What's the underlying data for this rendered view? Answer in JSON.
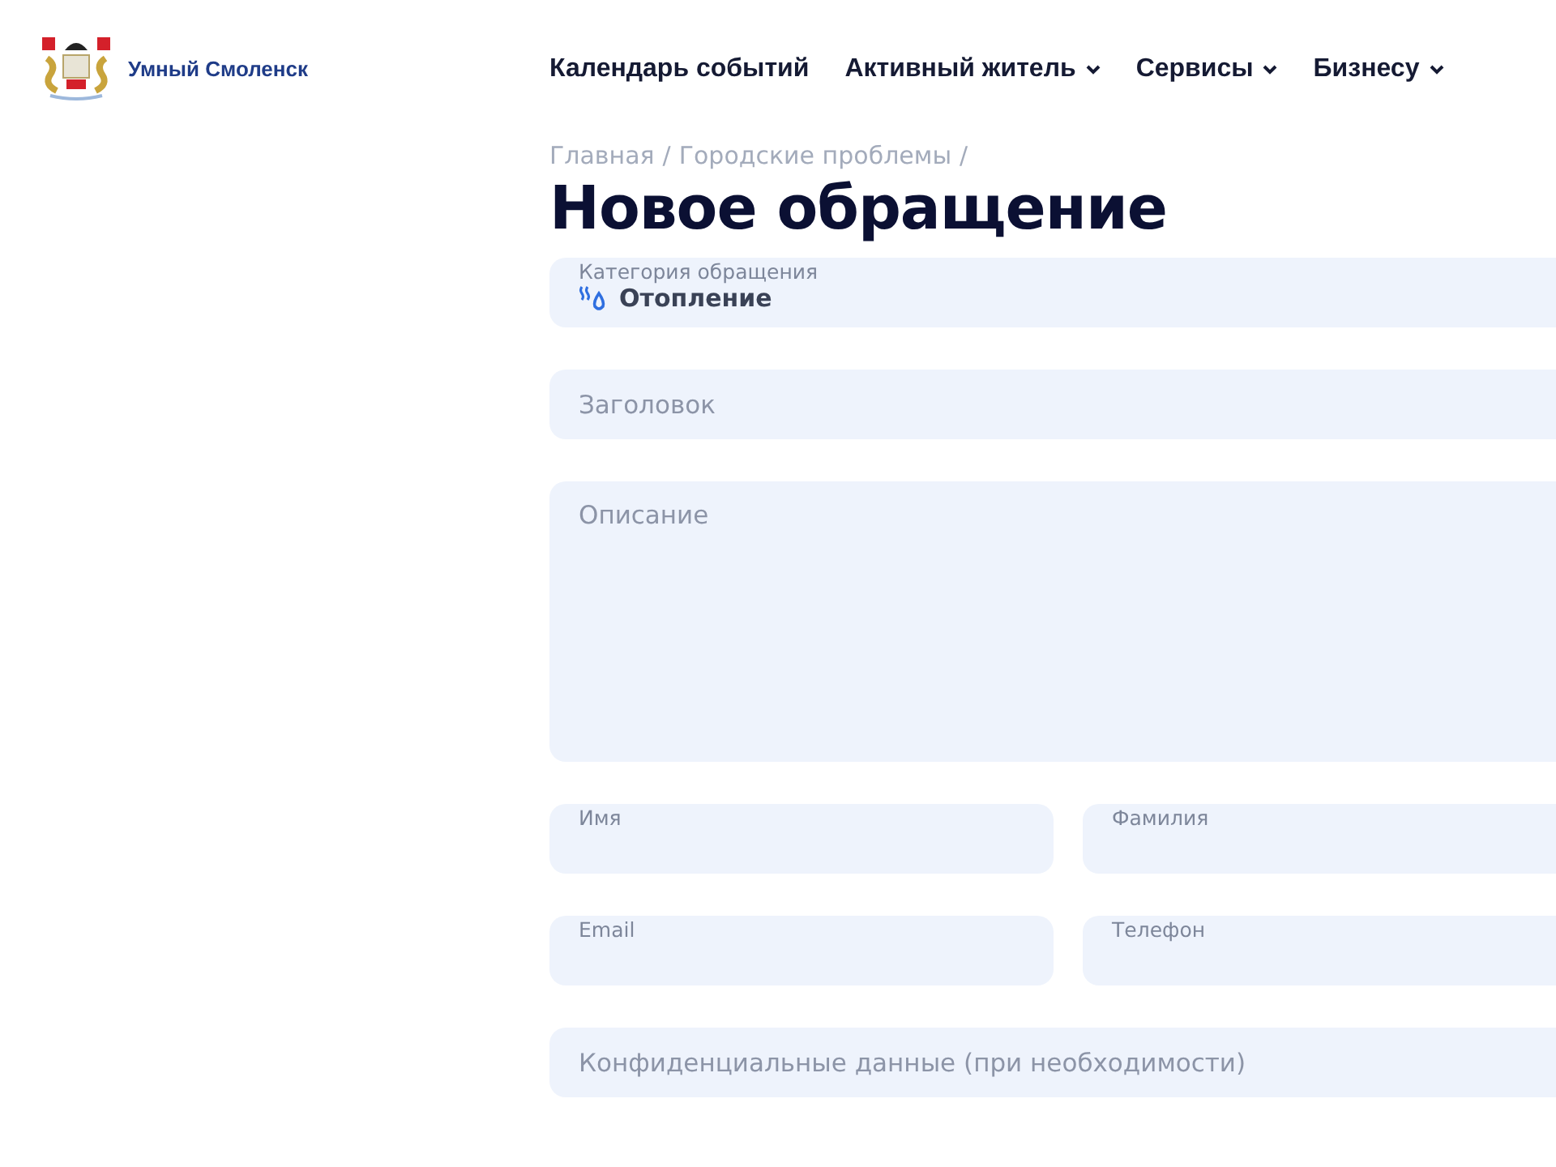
{
  "header": {
    "logo_text": "Умный Смоленск",
    "nav": [
      {
        "label": "Календарь событий",
        "has_dropdown": false
      },
      {
        "label": "Активный житель",
        "has_dropdown": true
      },
      {
        "label": "Сервисы",
        "has_dropdown": true
      },
      {
        "label": "Бизнесу",
        "has_dropdown": true
      }
    ]
  },
  "breadcrumbs": [
    {
      "label": "Главная",
      "separator": "/"
    },
    {
      "label": "Городские проблемы",
      "separator": "/"
    }
  ],
  "title": "Новое обращение",
  "form": {
    "rows": [
      [
        {
          "kind": "select",
          "label": "Категория обращения",
          "value": "Отопление"
        }
      ],
      [
        {
          "kind": "input",
          "placeholder": "Заголовок"
        }
      ],
      [
        {
          "kind": "textarea",
          "placeholder": "Описание"
        }
      ],
      [
        {
          "kind": "labeled",
          "label": "Имя"
        },
        {
          "kind": "labeled",
          "label": "Фамилия"
        }
      ],
      [
        {
          "kind": "labeled",
          "label": "Email"
        },
        {
          "kind": "labeled",
          "label": "Телефон"
        }
      ],
      [
        {
          "kind": "input",
          "placeholder": "Конфиденциальные данные (при необходимости)"
        }
      ]
    ]
  }
}
